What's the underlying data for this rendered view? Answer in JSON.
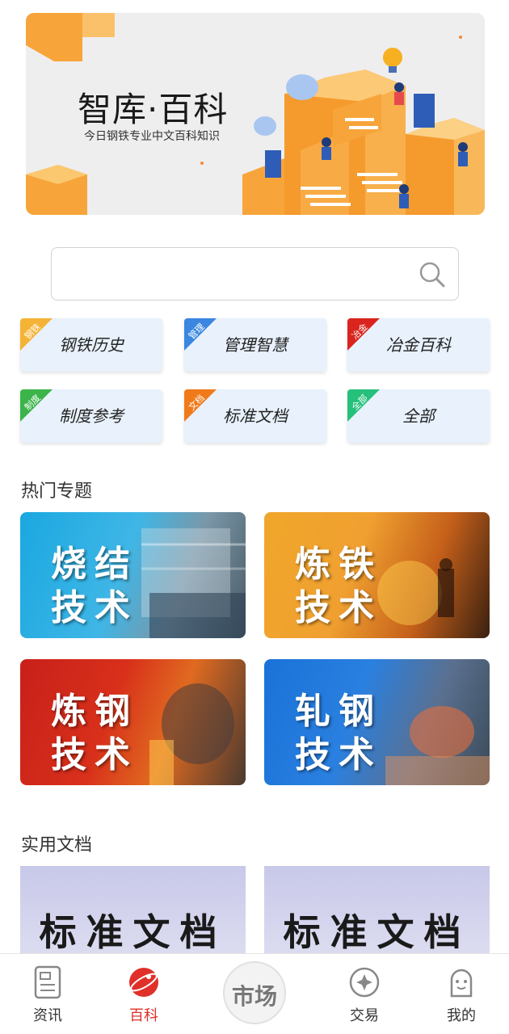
{
  "banner": {
    "title": "智库·百科",
    "subtitle": "今日钢铁专业中文百科知识"
  },
  "search": {
    "placeholder": "",
    "value": ""
  },
  "categories": [
    {
      "label": "钢铁历史",
      "tag": "钢铁",
      "color": "#f5b335"
    },
    {
      "label": "管理智慧",
      "tag": "管理",
      "color": "#3a86e0"
    },
    {
      "label": "冶金百科",
      "tag": "冶金",
      "color": "#d9251d"
    },
    {
      "label": "制度参考",
      "tag": "制度",
      "color": "#3bb44a"
    },
    {
      "label": "标准文档",
      "tag": "文档",
      "color": "#f07a1a"
    },
    {
      "label": "全部",
      "tag": "全部",
      "color": "#25c07a"
    }
  ],
  "hot_topics": {
    "title": "热门专题",
    "items": [
      {
        "line1": "烧结",
        "line2": "技术"
      },
      {
        "line1": "炼铁",
        "line2": "技术"
      },
      {
        "line1": "炼钢",
        "line2": "技术"
      },
      {
        "line1": "轧钢",
        "line2": "技术"
      }
    ]
  },
  "docs": {
    "title": "实用文档",
    "items": [
      {
        "label": "标准文档"
      },
      {
        "label": "标准文档"
      }
    ]
  },
  "nav": {
    "items": [
      {
        "label": "资讯",
        "icon": "news-icon"
      },
      {
        "label": "百科",
        "icon": "encyclopedia-icon"
      },
      {
        "label": "交易",
        "icon": "trade-icon"
      },
      {
        "label": "我的",
        "icon": "profile-icon"
      }
    ],
    "market_label": "市场",
    "active_color": "#e0302a"
  }
}
